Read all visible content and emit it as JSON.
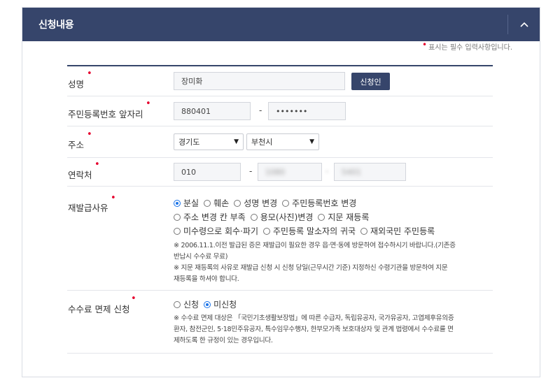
{
  "header": {
    "title": "신청내용"
  },
  "required_note": "표시는 필수 입력사항입니다.",
  "colors": {
    "header_bg": "#36456b",
    "required_dot": "#e6002d",
    "radio_checked": "#1a73e8"
  },
  "fields": {
    "name": {
      "label": "성명",
      "value": "장미화",
      "button_label": "신청인"
    },
    "resident_number": {
      "label": "주민등록번호 앞자리",
      "front": "880401",
      "separator": "-",
      "back": "•••••••"
    },
    "address": {
      "label": "주소",
      "province": "경기도",
      "city": "부천시"
    },
    "contact": {
      "label": "연락처",
      "part1": "010",
      "separator1": "-",
      "part2": "1080",
      "separator2": "-",
      "part3": "5401"
    },
    "reason": {
      "label": "재발급사유",
      "options": [
        "분실",
        "훼손",
        "성명 변경",
        "주민등록번호 변경",
        "주소 변경 칸 부족",
        "용모(사진)변경",
        "지문 재등록",
        "미수령으로 회수·파기",
        "주민등록 말소자의 귀국",
        "재외국민 주민등록"
      ],
      "selected": "분실",
      "note1_line1": "※ 2006.11.1.이전 발급된 증은 재발급이 필요한 경우 읍·면·동에 방문하여 접수하시기 바랍니다.(기존증",
      "note1_line2": "반납시 수수료 무료)",
      "note2_line1": "※ 지문 재등록의 사유로 재발급 신청 시 신청 당일(근무시간 기준) 지정하신 수령기관을 방문하여 지문",
      "note2_line2": "재등록을 하셔야 합니다."
    },
    "fee_exemption": {
      "label": "수수료 면제 신청",
      "options": [
        "신청",
        "미신청"
      ],
      "selected": "미신청",
      "note_line1": "※ 수수료 면제 대상은 「국민기초생활보장법」에 따른 수급자, 독립유공자, 국가유공자, 고엽제후유의증",
      "note_line2": "환자, 참전군인, 5·18민주유공자, 특수임무수행자, 한부모가족 보호대상자 및 관계 법령에서 수수료를 면",
      "note_line3": "제하도록 한 규정이 있는 경우입니다."
    }
  }
}
